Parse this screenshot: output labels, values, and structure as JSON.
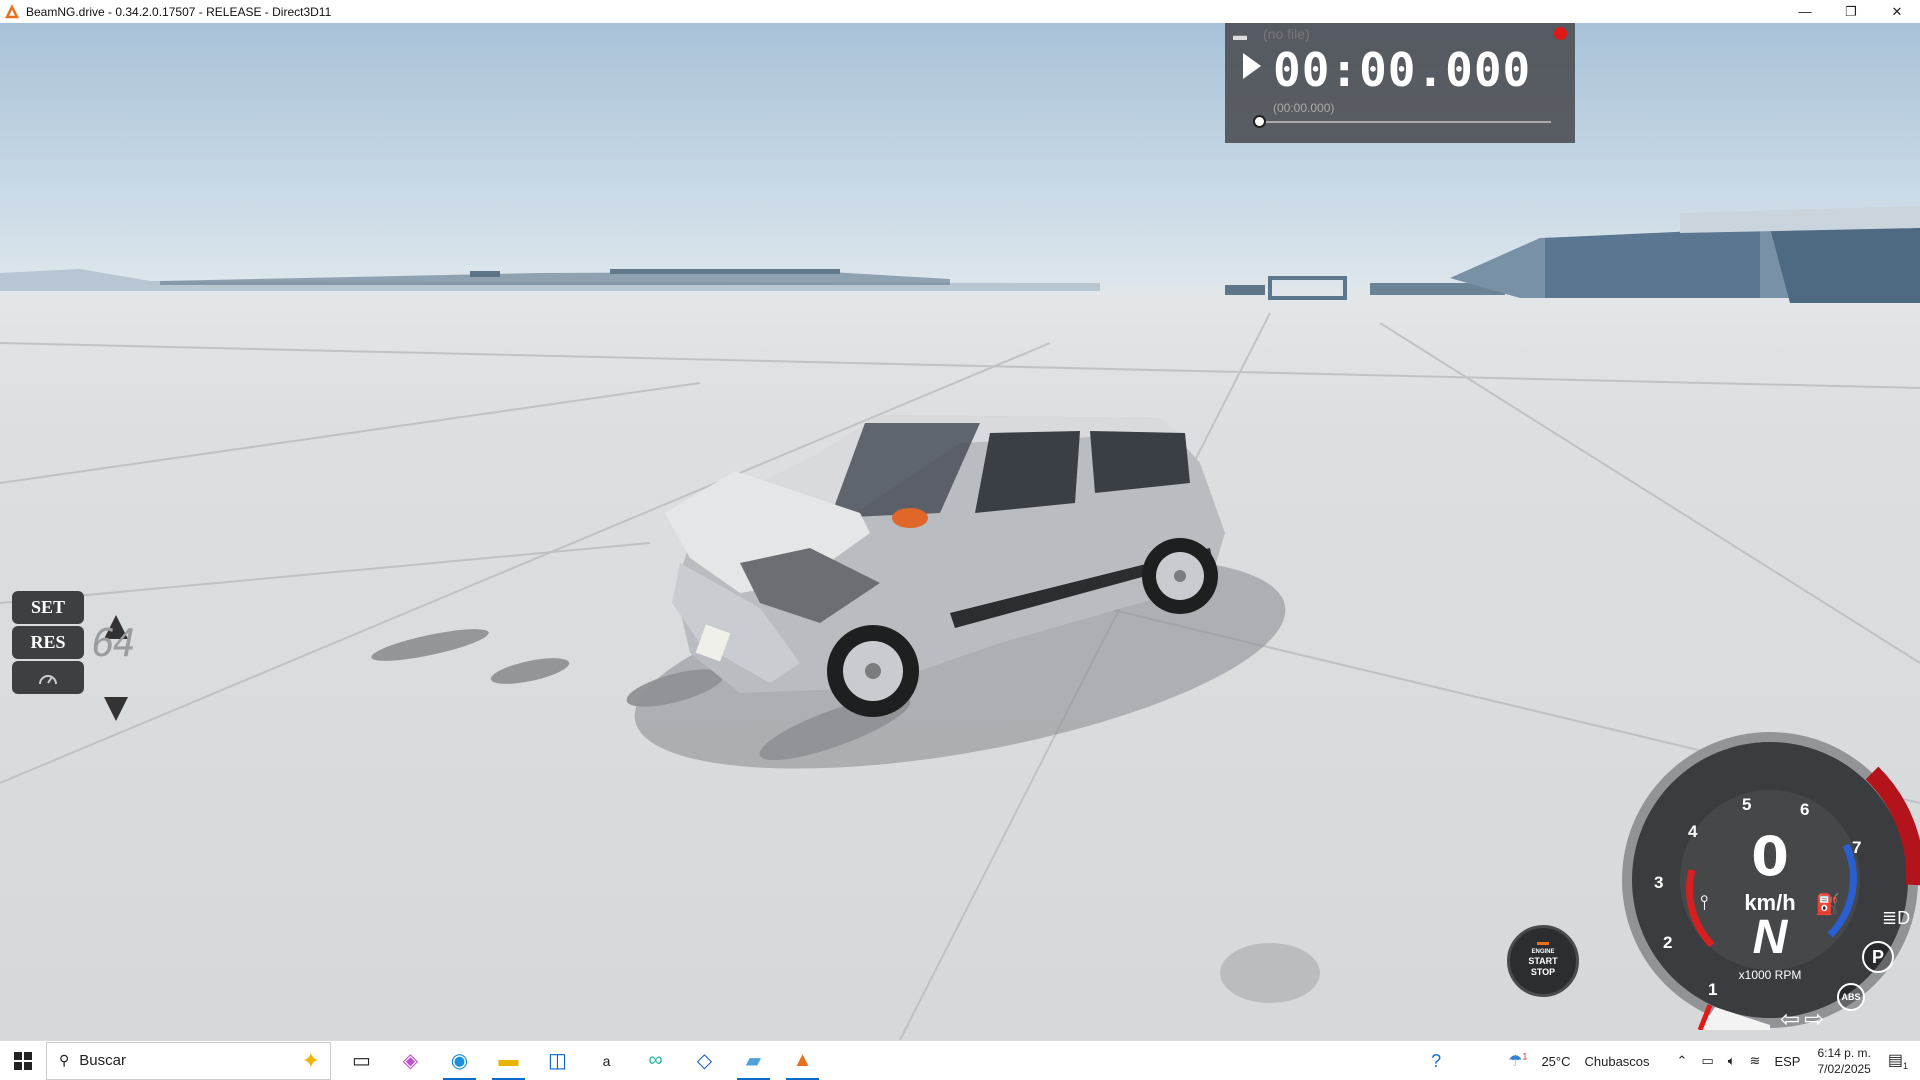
{
  "window": {
    "title": "BeamNG.drive - 0.34.2.0.17507 - RELEASE - Direct3D11",
    "minimize_icon": "—",
    "restore_icon": "❐",
    "close_icon": "✕"
  },
  "timer": {
    "file_label": "(no file)",
    "time": "00:00.000",
    "sub_time": "(00:00.000)"
  },
  "cruise_control": {
    "set_label": "SET",
    "res_label": "RES",
    "speed": "64"
  },
  "engine_button": {
    "line1": "ENGINE",
    "line2": "START",
    "line3": "STOP"
  },
  "gauge": {
    "speed": "0",
    "unit": "km/h",
    "gear": "N",
    "rpm_label": "x1000 RPM",
    "rpm_ticks": [
      "1",
      "2",
      "3",
      "4",
      "5",
      "6",
      "7"
    ],
    "park_label": "P",
    "abs_label": "ABS",
    "redline_color": "#b3131b",
    "fuel_color": "#2a5fd1",
    "temp_color": "#d62020"
  },
  "taskbar": {
    "search_placeholder": "Buscar",
    "weather_temp": "25°C",
    "weather_desc": "Chubascos",
    "language": "ESP",
    "time": "6:14 p. m.",
    "date": "7/02/2025",
    "notification_count": "1",
    "weather_badge": "1"
  }
}
